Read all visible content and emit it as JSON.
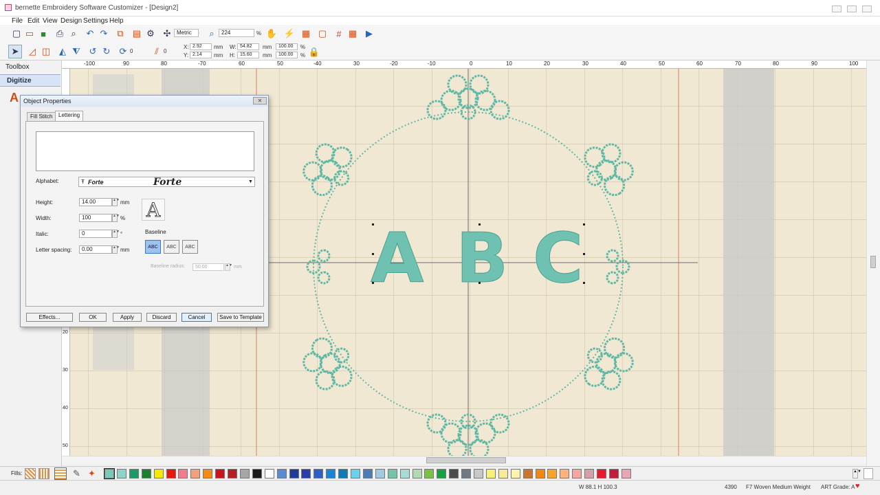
{
  "app": {
    "title": "bernette Embroidery Software Customizer - [Design2]"
  },
  "menu": [
    "File",
    "Edit",
    "View",
    "Design",
    "Settings",
    "Help"
  ],
  "toolbar": {
    "units": "Metric",
    "zoom": "224",
    "zoom_unit": "%",
    "rotate_value": "0",
    "slant_value": "0",
    "x_label": "X:",
    "x_value": "2.92",
    "y_label": "Y:",
    "y_value": "2.14",
    "w_label": "W:",
    "w_value": "54.82",
    "h_label": "H:",
    "h_value": "15.60",
    "unit_mm": "mm",
    "scale_w": "100.00",
    "scale_h": "100.00",
    "pct": "%"
  },
  "left_panel": {
    "toolbox": "Toolbox",
    "digitize": "Digitize",
    "letter_icon": "A"
  },
  "ruler": {
    "top": [
      "-100",
      "90",
      "80",
      "-70",
      "60",
      "50",
      "-40",
      "30",
      "-20",
      "-10",
      "0",
      "10",
      "20",
      "30",
      "40",
      "50",
      "60",
      "70",
      "80",
      "90",
      "100"
    ],
    "left": [
      "20",
      "30",
      "40",
      "50"
    ]
  },
  "design": {
    "letters": [
      "A",
      "B",
      "C"
    ],
    "thread_color": "#6fc2b1"
  },
  "dialog": {
    "title": "Object Properties",
    "close": "✕",
    "tabs": [
      "Fill Stitch",
      "Lettering"
    ],
    "active_tab": "Lettering",
    "text_value": "",
    "alphabet_label": "Alphabet:",
    "alphabet_value": "Forte",
    "alphabet_preview": "Forte",
    "height_label": "Height:",
    "height_value": "14.00",
    "height_unit": "mm",
    "width_label": "Width:",
    "width_value": "100",
    "width_unit": "%",
    "italic_label": "Italic:",
    "italic_value": "0",
    "italic_unit": "°",
    "spacing_label": "Letter spacing:",
    "spacing_value": "0.00",
    "spacing_unit": "mm",
    "baseline_label": "Baseline",
    "baseline_icons": [
      "ABC",
      "ABC",
      "ABC"
    ],
    "baseline_radius_label": "Baseline radius:",
    "baseline_radius_value": "50.00",
    "baseline_radius_unit": "mm",
    "buttons": {
      "effects": "Effects...",
      "ok": "OK",
      "apply": "Apply",
      "discard": "Discard",
      "cancel": "Cancel",
      "save_template": "Save to Template"
    }
  },
  "palette": {
    "label": "Fills:",
    "colors": [
      "#7cc8b8",
      "#8fd4c9",
      "#1c9a6a",
      "#1d7f2d",
      "#f7e800",
      "#e8190c",
      "#f07b8a",
      "#f0a07a",
      "#f28c16",
      "#c8141e",
      "#b22026",
      "#a6a6a6",
      "#1c1c1c",
      "#ffffff",
      "#5c8ad1",
      "#1f3c99",
      "#2a3ea6",
      "#2d5fc4",
      "#1a84d6",
      "#0f7ab5",
      "#6cd0e8",
      "#4a7cb6",
      "#a3c9e0",
      "#76c4a8",
      "#a6dcd2",
      "#b2d8b5",
      "#7cc04a",
      "#18a043",
      "#4c4c4c",
      "#6f7a85",
      "#c8c8c8",
      "#f5f07a",
      "#f7eb9a",
      "#fff3b0",
      "#c8762e",
      "#f08818",
      "#f7a32c",
      "#ffb27a",
      "#f6a6a0",
      "#d6a0a8",
      "#e8192c",
      "#c41c3c",
      "#e8a6b5"
    ]
  },
  "status": {
    "size": "W 88.1 H 100.3",
    "stitches": "4390",
    "fabric": "F7 Woven Medium Weight",
    "art_grade": "ART Grade: A"
  }
}
